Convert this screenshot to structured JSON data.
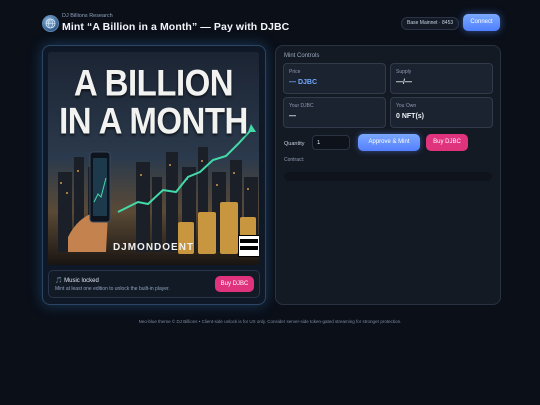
{
  "header": {
    "brand_subtitle": "DJ Billions Research",
    "title": "Mint “A Billion in a Month” — Pay with DJBC",
    "network": "Base Mainnet · 8453",
    "connect_label": "Connect",
    "logo_icon": "globe-logo-icon"
  },
  "artwork": {
    "title_line1": "A BILLION",
    "title_line2": "IN A MONTH",
    "artist": "DJMONDOENT",
    "advisory_icon": "parental-advisory-icon"
  },
  "player": {
    "title": "🎵 Music locked",
    "description": "Mint at least one edition to unlock the built-in player.",
    "buy_label": "Buy DJBC"
  },
  "mint": {
    "section_title": "Mint Controls",
    "stats": [
      {
        "label": "Price",
        "value": "— DJBC"
      },
      {
        "label": "Supply",
        "value": "—/—"
      },
      {
        "label": "Your DJBC",
        "value": "—"
      },
      {
        "label": "You Own",
        "value": "0 NFT(s)"
      }
    ],
    "quantity_label": "Quantity",
    "quantity_value": "1",
    "approve_label": "Approve & Mint",
    "buy_label": "Buy DJBC",
    "contract_label": "Contract:"
  },
  "footer": {
    "text": "Neo-blue theme © DJ Billions • Client-side unlock is for UX only. Consider server-side token-gated streaming for stronger protection."
  },
  "colors": {
    "background": "#0a0f18",
    "accent_blue": "#5a8cff",
    "accent_pink": "#e0337e"
  }
}
